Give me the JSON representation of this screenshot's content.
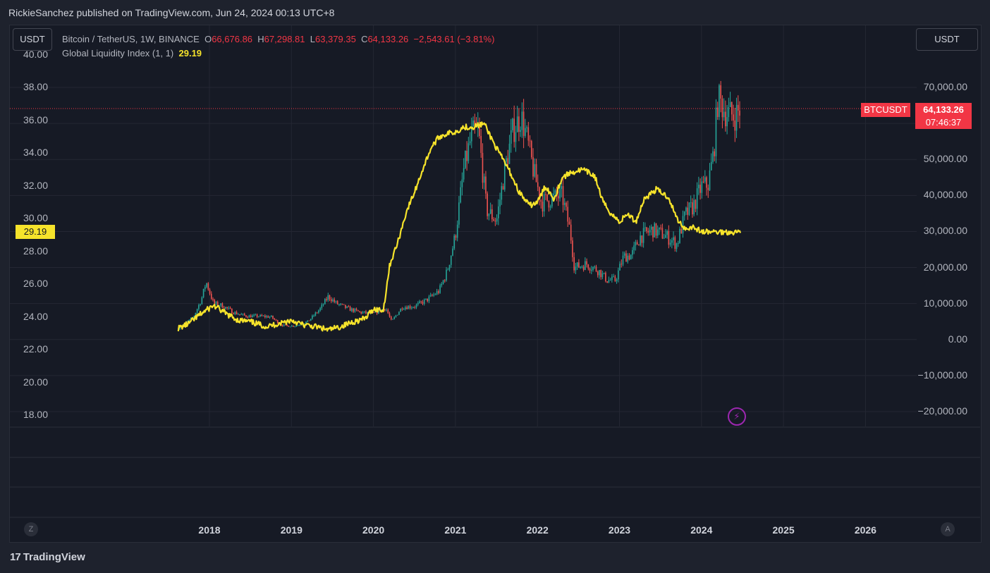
{
  "header": {
    "text": "RickieSanchez published on TradingView.com, Jun 24, 2024 00:13 UTC+8"
  },
  "units": {
    "left": "USDT",
    "right": "USDT"
  },
  "legend": {
    "line1_name": "Bitcoin / TetherUS, 1W, BINANCE",
    "o_label": "O",
    "o_val": "66,676.86",
    "h_label": "H",
    "h_val": "67,298.81",
    "l_label": "L",
    "l_val": "63,379.35",
    "c_label": "C",
    "c_val": "64,133.26",
    "change": "−2,543.61 (−3.81%)",
    "line2_name": "Global Liquidity Index (1, 1)",
    "gli_val": "29.19"
  },
  "badges": {
    "symbol": "BTCUSDT",
    "price": "64,133.26",
    "countdown": "07:46:37",
    "gli": "29.19"
  },
  "footer": {
    "brand": "TradingView",
    "logo_mark": "17"
  },
  "buttons": {
    "z": "Z",
    "a": "A"
  },
  "colors": {
    "up": "#26a69a",
    "down": "#ef5350",
    "line": "#f6e32b",
    "price_tag": "#f23645"
  },
  "chart_data": {
    "type": "line",
    "x_ticks": [
      "2018",
      "2019",
      "2020",
      "2021",
      "2022",
      "2023",
      "2024",
      "2025",
      "2026"
    ],
    "left_axis": {
      "ticks": [
        "40.00",
        "38.00",
        "36.00",
        "34.00",
        "32.00",
        "30.00",
        "28.00",
        "26.00",
        "24.00",
        "22.00",
        "20.00",
        "18.00"
      ],
      "ylim": [
        18,
        40
      ]
    },
    "right_axis": {
      "ticks": [
        "70,000.00",
        "60,000.00",
        "50,000.00",
        "40,000.00",
        "30,000.00",
        "20,000.00",
        "10,000.00",
        "0.00",
        "−10,000.00",
        "−20,000.00"
      ],
      "ylim": [
        -20000,
        80000
      ]
    },
    "btc_series": {
      "x": [
        2017.62,
        2017.7,
        2017.8,
        2017.9,
        2017.96,
        2018.05,
        2018.15,
        2018.3,
        2018.45,
        2018.6,
        2018.75,
        2018.88,
        2018.95,
        2019.05,
        2019.2,
        2019.35,
        2019.45,
        2019.55,
        2019.7,
        2019.85,
        2020.0,
        2020.15,
        2020.22,
        2020.35,
        2020.5,
        2020.65,
        2020.8,
        2020.9,
        2021.0,
        2021.1,
        2021.2,
        2021.28,
        2021.38,
        2021.5,
        2021.6,
        2021.7,
        2021.8,
        2021.86,
        2021.95,
        2022.05,
        2022.15,
        2022.3,
        2022.4,
        2022.45,
        2022.6,
        2022.75,
        2022.85,
        2022.95,
        2023.05,
        2023.15,
        2023.25,
        2023.4,
        2023.55,
        2023.7,
        2023.8,
        2023.9,
        2024.0,
        2024.08,
        2024.15,
        2024.2,
        2024.3,
        2024.4,
        2024.48
      ],
      "close": [
        3000,
        4500,
        6000,
        11000,
        16000,
        10000,
        9500,
        7500,
        6500,
        6500,
        6300,
        4000,
        3800,
        3800,
        5000,
        8500,
        12000,
        10000,
        8500,
        7500,
        7200,
        8800,
        5000,
        9000,
        9200,
        11000,
        13500,
        19000,
        29000,
        47000,
        57000,
        58000,
        36000,
        33000,
        47000,
        58000,
        62000,
        57000,
        47000,
        38000,
        39000,
        40000,
        30000,
        20000,
        21000,
        19000,
        16500,
        16500,
        23000,
        23500,
        28500,
        30500,
        29000,
        26500,
        34500,
        37000,
        42500,
        43000,
        52000,
        67000,
        63000,
        62000,
        64133
      ]
    },
    "gli_series": {
      "x": [
        2017.62,
        2017.75,
        2017.9,
        2018.05,
        2018.2,
        2018.35,
        2018.5,
        2018.7,
        2018.85,
        2019.0,
        2019.15,
        2019.3,
        2019.45,
        2019.6,
        2019.75,
        2019.9,
        2020.0,
        2020.12,
        2020.2,
        2020.3,
        2020.4,
        2020.5,
        2020.6,
        2020.7,
        2020.8,
        2020.9,
        2021.0,
        2021.1,
        2021.2,
        2021.35,
        2021.5,
        2021.65,
        2021.78,
        2021.9,
        2022.0,
        2022.1,
        2022.2,
        2022.3,
        2022.4,
        2022.55,
        2022.7,
        2022.8,
        2022.9,
        2023.0,
        2023.1,
        2023.2,
        2023.3,
        2023.45,
        2023.6,
        2023.7,
        2023.8,
        2023.9,
        2024.0,
        2024.1,
        2024.2,
        2024.3,
        2024.4,
        2024.48
      ],
      "values": [
        23.3,
        23.6,
        24.2,
        24.7,
        24.2,
        23.8,
        23.7,
        23.4,
        23.6,
        23.8,
        23.5,
        23.4,
        23.2,
        23.4,
        23.7,
        23.9,
        24.5,
        24.4,
        27.2,
        28.6,
        30.4,
        31.6,
        33.0,
        34.3,
        35.0,
        35.2,
        35.3,
        35.6,
        35.6,
        35.8,
        34.3,
        33.0,
        31.6,
        30.8,
        31.0,
        32.0,
        31.2,
        32.5,
        32.8,
        33.0,
        32.6,
        31.0,
        30.3,
        29.8,
        30.3,
        29.8,
        31.2,
        31.8,
        31.3,
        30.0,
        29.4,
        29.5,
        29.2,
        29.19,
        29.19,
        29.19,
        29.19,
        29.19
      ]
    }
  }
}
